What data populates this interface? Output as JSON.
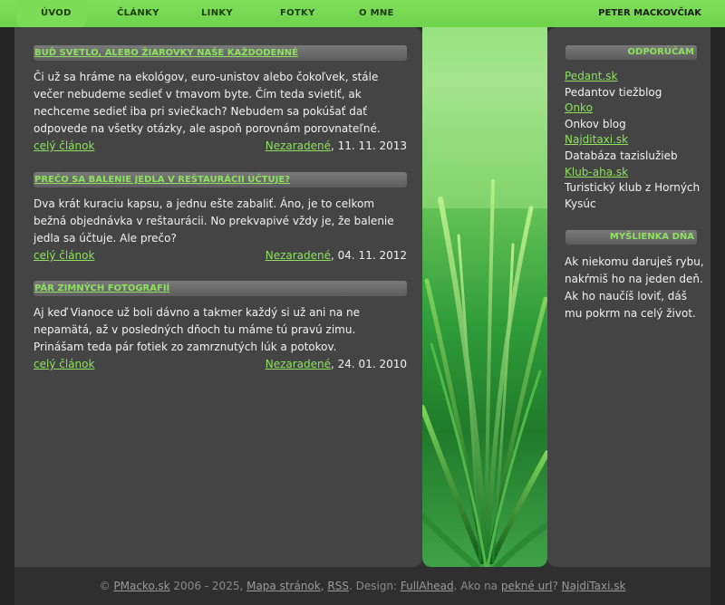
{
  "nav": {
    "items": [
      {
        "label": "ÚVOD",
        "active": true
      },
      {
        "label": "ČLÁNKY",
        "active": false
      },
      {
        "label": "LINKY",
        "active": false
      },
      {
        "label": "FOTKY",
        "active": false
      },
      {
        "label": "O MNE",
        "active": false
      }
    ],
    "author": "PETER MACKOVČIAK"
  },
  "articles": [
    {
      "title": "Buď svetlo, alebo žiarovky naše každodenné",
      "text": "Či už sa hráme na ekológov, euro-unistov alebo čokoľvek, stále večer nebudeme sedieť v tmavom byte. Čím teda svietiť, ak nechceme sedieť iba pri sviečkach? Nebudem sa pokúšať dať odpovede na všetky otázky, ale aspoň porovnám porovnateľné.",
      "more": "celý článok",
      "category": "Nezaradené",
      "date": ", 11. 11. 2013"
    },
    {
      "title": "Prečo sa balenie jedla v reštaurácii účtuje?",
      "text": "Dva krát kuraciu kapsu, a jednu ešte zabaliť. Áno, je to celkom bežná objednávka v reštaurácii. No prekvapivé vždy je, že balenie jedla sa účtuje. Ale prečo?",
      "more": "celý článok",
      "category": "Nezaradené",
      "date": ", 04. 11. 2012"
    },
    {
      "title": "Pár zimných fotografií",
      "text": "Aj keď Vianoce už boli dávno a takmer každý si už ani na ne nepamätá, až v posledných dňoch tu máme tú pravú zimu. Prinášam teda pár fotiek zo zamrznutých lúk a potokov.",
      "more": "celý článok",
      "category": "Nezaradené",
      "date": ", 24. 01. 2010"
    }
  ],
  "sidebar": {
    "recommend_heading": "ODPORÚČAM",
    "links": [
      {
        "label": "Pedant.sk",
        "desc": "Pedantov tiežblog"
      },
      {
        "label": "Onko",
        "desc": "Onkov blog"
      },
      {
        "label": "Najditaxi.sk",
        "desc": "Databáza tazislužieb"
      },
      {
        "label": "Klub-aha.sk",
        "desc": "Turistický klub z Horných Kysúc"
      }
    ],
    "thought_heading": "MYŠLIENKA DŇA",
    "thought": "Ak niekomu daruješ rybu, nakŕmiš ho na jeden deň. Ak ho naučíš loviť, dáš mu pokrm na celý život."
  },
  "footer": {
    "copy": "©",
    "site": "PMacko.sk",
    "years": " 2006 - 2025, ",
    "sitemap": "Mapa stránok",
    "sep1": ", ",
    "rss": "RSS",
    "design_prefix": ". Design: ",
    "design": "FullAhead",
    "mid": ". Ako na ",
    "pretty": "pekné url",
    "q": "? ",
    "taxi": "NajdiTaxi.sk"
  },
  "colors": {
    "accent": "#8de35e",
    "panel": "#444444",
    "nav_bg": "#7cdc58"
  }
}
